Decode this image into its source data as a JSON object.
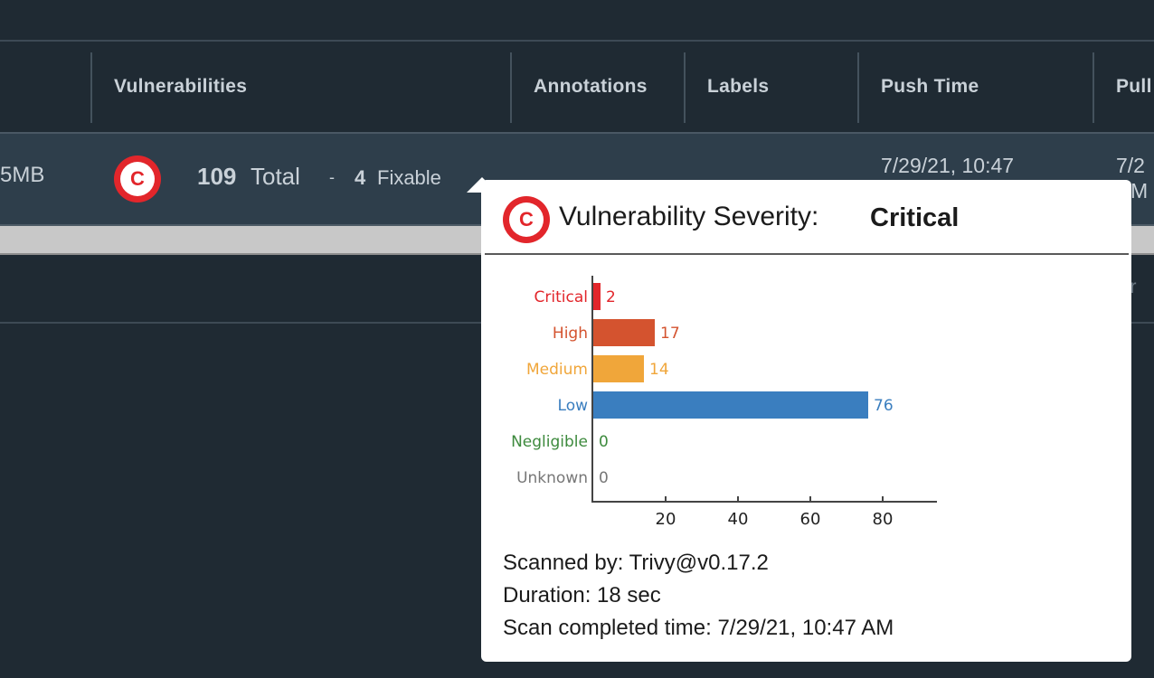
{
  "table": {
    "headers": {
      "vulnerabilities": "Vulnerabilities",
      "annotations": "Annotations",
      "labels": "Labels",
      "push_time": "Push Time",
      "pull_time": "Pull"
    },
    "row": {
      "size": "5MB",
      "severity_letter": "C",
      "total_count": "109",
      "total_label": "Total",
      "separator": "-",
      "fixable_count": "4",
      "fixable_label": "Fixable",
      "push_time": "7/29/21, 10:47",
      "pull_time_line1": "7/2",
      "pull_time_line2": "M"
    },
    "second_row_fragment": "ter"
  },
  "tooltip": {
    "badge_letter": "C",
    "title_prefix": "Vulnerability Severity:",
    "title_value": "Critical",
    "scanned_by": "Scanned by:  Trivy@v0.17.2",
    "duration": "Duration: 18 sec",
    "completed": "Scan completed time: 7/29/21, 10:47 AM"
  },
  "colors": {
    "critical": "#e2262b",
    "high": "#d4532f",
    "medium": "#f0a63a",
    "low": "#3a7ebf",
    "negligible": "#3d8a3d",
    "unknown": "#777777"
  },
  "chart_data": {
    "type": "bar",
    "orientation": "horizontal",
    "categories": [
      "Critical",
      "High",
      "Medium",
      "Low",
      "Negligible",
      "Unknown"
    ],
    "values": [
      2,
      17,
      14,
      76,
      0,
      0
    ],
    "colors": [
      "#e2262b",
      "#d4532f",
      "#f0a63a",
      "#3a7ebf",
      "#3d8a3d",
      "#777777"
    ],
    "xticks": [
      20,
      40,
      60,
      80
    ],
    "xlim": [
      0,
      95
    ]
  }
}
